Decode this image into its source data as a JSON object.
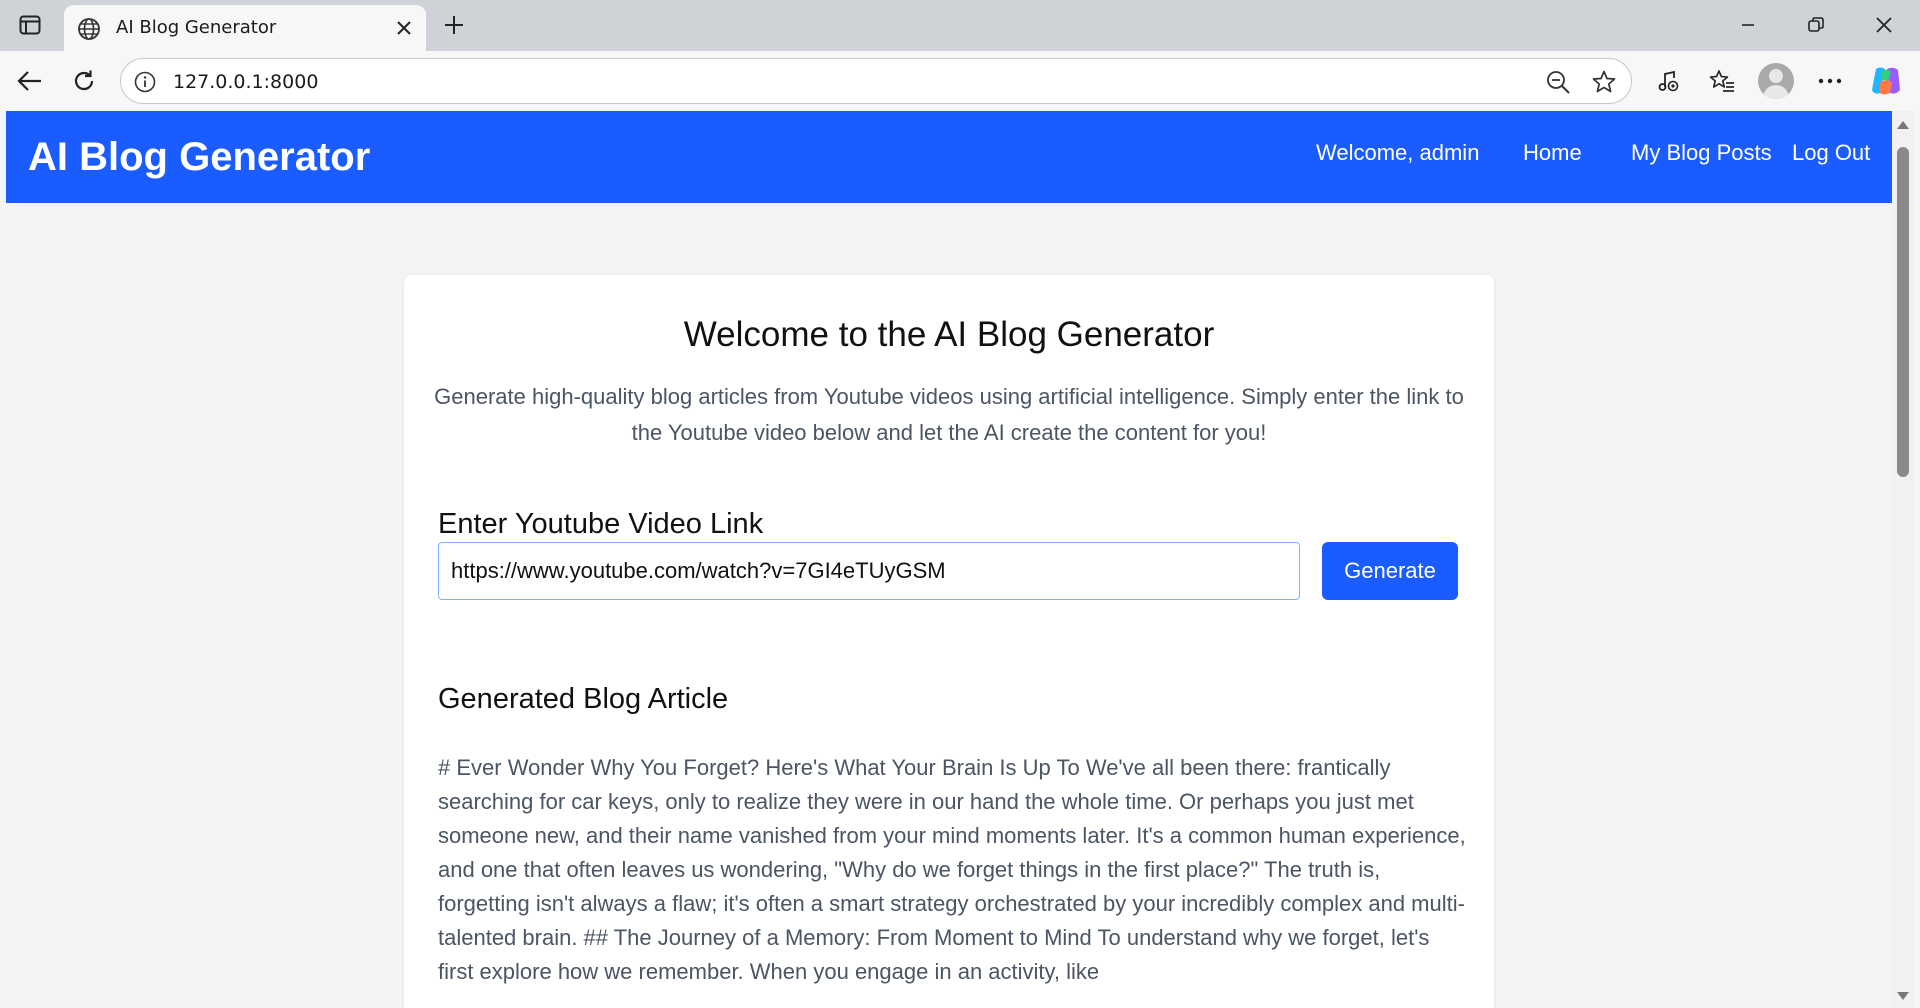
{
  "browser": {
    "tab_title": "AI Blog Generator",
    "url": "127.0.0.1:8000"
  },
  "header": {
    "brand": "AI Blog Generator",
    "welcome": "Welcome, admin",
    "nav_home": "Home",
    "nav_posts": "My Blog Posts",
    "nav_logout": "Log Out"
  },
  "main": {
    "title": "Welcome to the AI Blog Generator",
    "intro": "Generate high-quality blog articles from Youtube videos using artificial intelligence. Simply enter the link to the Youtube video below and let the AI create the content for you!",
    "link_heading": "Enter Youtube Video Link",
    "link_value": "https://www.youtube.com/watch?v=7GI4eTUyGSM",
    "generate_label": "Generate",
    "article_heading": "Generated Blog Article",
    "article_text": "# Ever Wonder Why You Forget? Here's What Your Brain Is Up To We've all been there: frantically searching for car keys, only to realize they were in our hand the whole time. Or perhaps you just met someone new, and their name vanished from your mind moments later. It's a common human experience, and one that often leaves us wondering, \"Why do we forget things in the first place?\" The truth is, forgetting isn't always a flaw; it's often a smart strategy orchestrated by your incredibly complex and multi-talented brain. ## The Journey of a Memory: From Moment to Mind To understand why we forget, let's first explore how we remember. When you engage in an activity, like"
  },
  "colors": {
    "brand_blue": "#1a5cff",
    "page_bg": "#f3f4f6"
  }
}
